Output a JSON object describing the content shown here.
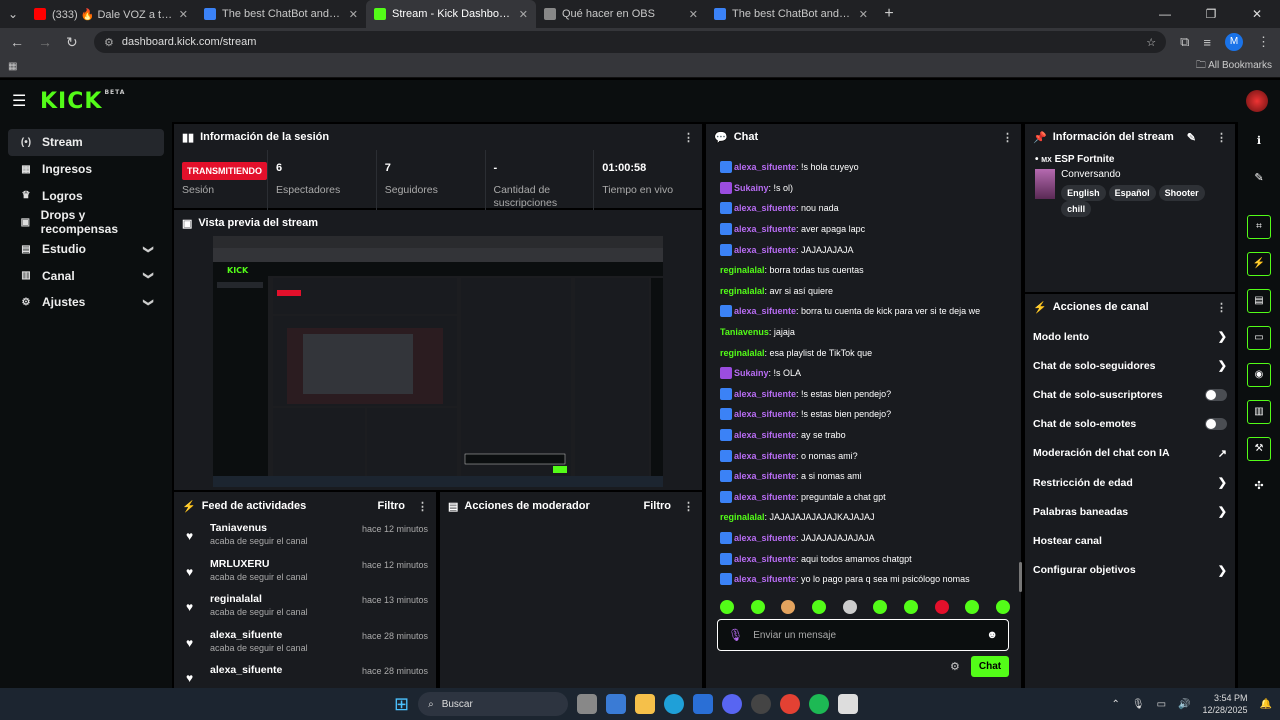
{
  "browser": {
    "tabs": [
      {
        "title": "(333) 🔥 Dale VOZ a tu STREAM",
        "favicon_color": "#ff0000",
        "active": false
      },
      {
        "title": "The best ChatBot and Widgets",
        "favicon_color": "#3b82f6",
        "active": false
      },
      {
        "title": "Stream - Kick Dashboard",
        "favicon_color": "#53fc18",
        "active": true
      },
      {
        "title": "Qué hacer en OBS",
        "favicon_color": "#888888",
        "active": false
      },
      {
        "title": "The best ChatBot and Widgets",
        "favicon_color": "#3b82f6",
        "active": false
      }
    ],
    "url": "dashboard.kick.com/stream",
    "all_bookmarks": "All Bookmarks",
    "profile_initial": "M"
  },
  "app": {
    "logo": "KICK",
    "beta": "BETA"
  },
  "sidebar": {
    "items": [
      {
        "label": "Stream",
        "icon": "stream-icon",
        "glyph": "(•)",
        "active": true,
        "chevron": false
      },
      {
        "label": "Ingresos",
        "icon": "money-icon",
        "glyph": "▦",
        "active": false,
        "chevron": false
      },
      {
        "label": "Logros",
        "icon": "trophy-icon",
        "glyph": "♛",
        "active": false,
        "chevron": false
      },
      {
        "label": "Drops y recompensas",
        "icon": "gift-icon",
        "glyph": "▣",
        "active": false,
        "chevron": false
      },
      {
        "label": "Estudio",
        "icon": "studio-icon",
        "glyph": "▤",
        "active": false,
        "chevron": true
      },
      {
        "label": "Canal",
        "icon": "channel-icon",
        "glyph": "▥",
        "active": false,
        "chevron": true
      },
      {
        "label": "Ajustes",
        "icon": "settings-icon",
        "glyph": "⚙",
        "active": false,
        "chevron": true
      }
    ]
  },
  "session": {
    "title": "Información de la sesión",
    "stats": [
      {
        "value": "TRANSMITIENDO",
        "label": "Sesión",
        "badge": true
      },
      {
        "value": "6",
        "label": "Espectadores",
        "badge": false
      },
      {
        "value": "7",
        "label": "Seguidores",
        "badge": false
      },
      {
        "value": "-",
        "label": "Cantidad de suscripciones",
        "badge": false
      },
      {
        "value": "01:00:58",
        "label": "Tiempo en vivo",
        "badge": false
      }
    ]
  },
  "preview": {
    "title": "Vista previa del stream"
  },
  "feed": {
    "title": "Feed de actividades",
    "filter": "Filtro",
    "items": [
      {
        "name": "Taniavenus",
        "action": "acaba de seguir el canal",
        "time": "hace 12 minutos"
      },
      {
        "name": "MRLUXERU",
        "action": "acaba de seguir el canal",
        "time": "hace 12 minutos"
      },
      {
        "name": "reginalalal",
        "action": "acaba de seguir el canal",
        "time": "hace 13 minutos"
      },
      {
        "name": "alexa_sifuente",
        "action": "acaba de seguir el canal",
        "time": "hace 28 minutos"
      },
      {
        "name": "alexa_sifuente",
        "action": "",
        "time": "hace 28 minutos"
      }
    ]
  },
  "modactions": {
    "title": "Acciones de moderador",
    "filter": "Filtro"
  },
  "chat": {
    "title": "Chat",
    "messages": [
      {
        "user": "alexa_sifuente",
        "text": ": !s hola cuyeyo",
        "color": "#b76cf2",
        "badge": "#3b82f6"
      },
      {
        "user": "Sukainy",
        "text": ": !s ol)",
        "color": "#b76cf2",
        "badge": "#9b4de0"
      },
      {
        "user": "alexa_sifuente",
        "text": ": nou nada",
        "color": "#b76cf2",
        "badge": "#3b82f6"
      },
      {
        "user": "alexa_sifuente",
        "text": ": aver apaga lapc",
        "color": "#b76cf2",
        "badge": "#3b82f6"
      },
      {
        "user": "alexa_sifuente",
        "text": ": JAJAJAJAJA",
        "color": "#b76cf2",
        "badge": "#3b82f6"
      },
      {
        "user": "reginalalal",
        "text": ": borra todas tus cuentas",
        "color": "#53fc18",
        "badge": ""
      },
      {
        "user": "reginalalal",
        "text": ": avr si así quiere",
        "color": "#53fc18",
        "badge": ""
      },
      {
        "user": "alexa_sifuente",
        "text": ": borra tu cuenta de kick para ver si te deja we",
        "color": "#b76cf2",
        "badge": "#3b82f6"
      },
      {
        "user": "Taniavenus",
        "text": ": jajaja",
        "color": "#53fc18",
        "badge": ""
      },
      {
        "user": "reginalalal",
        "text": ": esa playlist de TikTok que",
        "color": "#53fc18",
        "badge": ""
      },
      {
        "user": "Sukainy",
        "text": ": !s OLA",
        "color": "#b76cf2",
        "badge": "#9b4de0"
      },
      {
        "user": "alexa_sifuente",
        "text": ": !s estas bien pendejo?",
        "color": "#b76cf2",
        "badge": "#3b82f6"
      },
      {
        "user": "alexa_sifuente",
        "text": ": !s estas bien pendejo?",
        "color": "#b76cf2",
        "badge": "#3b82f6"
      },
      {
        "user": "alexa_sifuente",
        "text": ": ay se trabo",
        "color": "#b76cf2",
        "badge": "#3b82f6"
      },
      {
        "user": "alexa_sifuente",
        "text": ": o nomas ami?",
        "color": "#b76cf2",
        "badge": "#3b82f6"
      },
      {
        "user": "alexa_sifuente",
        "text": ": a si nomas ami",
        "color": "#b76cf2",
        "badge": "#3b82f6"
      },
      {
        "user": "alexa_sifuente",
        "text": ": preguntale a chat gpt",
        "color": "#b76cf2",
        "badge": "#3b82f6"
      },
      {
        "user": "reginalalal",
        "text": ": JAJAJAJAJAJAJKAJAJAJ",
        "color": "#53fc18",
        "badge": ""
      },
      {
        "user": "alexa_sifuente",
        "text": ": JAJAJAJAJAJAJA",
        "color": "#b76cf2",
        "badge": "#3b82f6"
      },
      {
        "user": "alexa_sifuente",
        "text": ": aqui todos amamos chatgpt",
        "color": "#b76cf2",
        "badge": "#3b82f6"
      },
      {
        "user": "alexa_sifuente",
        "text": ": yo lo pago para q sea mi psicólogo nomas",
        "color": "#b76cf2",
        "badge": "#3b82f6"
      }
    ],
    "input_placeholder": "Enviar un mensaje",
    "send_label": "Chat"
  },
  "streaminfo": {
    "title": "Información del stream",
    "flag": "MX",
    "category": "ESP Fortnite",
    "stream_title": "Conversando",
    "tags": [
      "English",
      "Español",
      "Shooter",
      "chill"
    ]
  },
  "channel_actions": {
    "title": "Acciones de canal",
    "items": [
      {
        "label": "Modo lento",
        "control": "arrow"
      },
      {
        "label": "Chat de solo-seguidores",
        "control": "arrow"
      },
      {
        "label": "Chat de solo-suscriptores",
        "control": "toggle"
      },
      {
        "label": "Chat de solo-emotes",
        "control": "toggle"
      },
      {
        "label": "Moderación del chat con IA",
        "control": "external"
      },
      {
        "label": "Restricción de edad",
        "control": "arrow"
      },
      {
        "label": "Palabras baneadas",
        "control": "arrow"
      },
      {
        "label": "Hostear canal",
        "control": "none"
      },
      {
        "label": "Configurar objetivos",
        "control": "arrow"
      }
    ]
  },
  "taskbar": {
    "search": "Buscar",
    "time": "3:54 PM",
    "date": "12/28/2025"
  }
}
